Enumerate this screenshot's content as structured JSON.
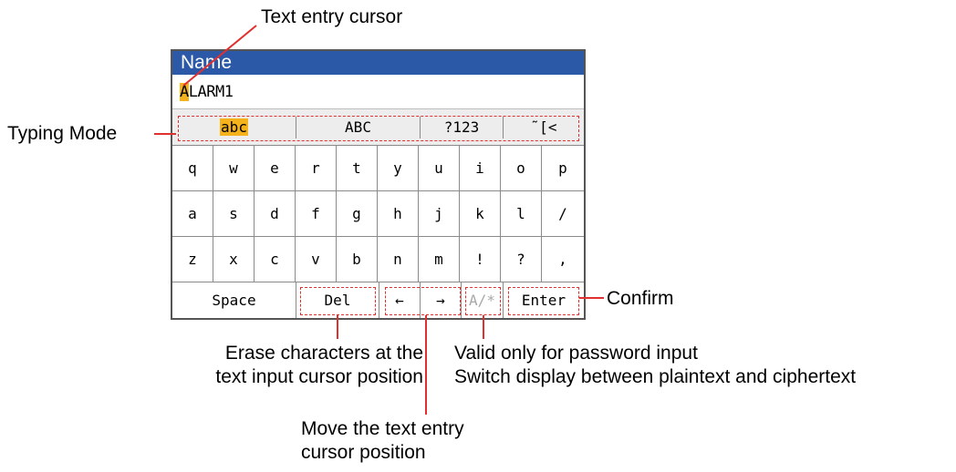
{
  "panel": {
    "title": "Name",
    "entry_cursor_char": "A",
    "entry_rest": "LARM1"
  },
  "modes": [
    {
      "label": "abc",
      "selected": true
    },
    {
      "label": "ABC",
      "selected": false
    },
    {
      "label": "?123",
      "selected": false
    },
    {
      "label": "˜[<",
      "selected": false
    }
  ],
  "keys": [
    [
      "q",
      "w",
      "e",
      "r",
      "t",
      "y",
      "u",
      "i",
      "o",
      "p"
    ],
    [
      "a",
      "s",
      "d",
      "f",
      "g",
      "h",
      "j",
      "k",
      "l",
      "/"
    ],
    [
      "z",
      "x",
      "c",
      "v",
      "b",
      "n",
      "m",
      "!",
      "?",
      ","
    ]
  ],
  "bottom": {
    "space": "Space",
    "del": "Del",
    "left": "←",
    "right": "→",
    "mask": "A/*",
    "enter": "Enter"
  },
  "annotations": {
    "cursor": "Text entry cursor",
    "typing_mode": "Typing Mode",
    "confirm": "Confirm",
    "erase_1": "Erase characters at the",
    "erase_2": "text input cursor position",
    "password_1": "Valid only for password input",
    "password_2": "Switch display between plaintext and ciphertext",
    "move_1": "Move the text entry",
    "move_2": "cursor position"
  },
  "colors": {
    "titlebar": "#2c58a8",
    "highlight": "#f5b21a",
    "leader": "#e03030"
  }
}
